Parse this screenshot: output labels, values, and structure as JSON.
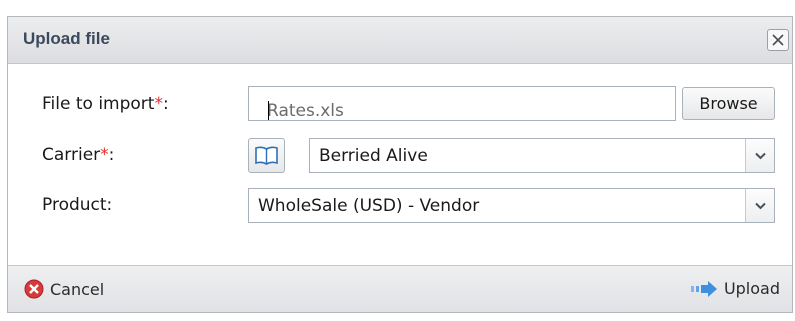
{
  "dialog": {
    "title": "Upload file"
  },
  "form": {
    "file_label": "File to import",
    "file_value": "Rates.xls",
    "browse_label": "Browse",
    "carrier_label": "Carrier",
    "carrier_value": "Berried Alive",
    "product_label": "Product:",
    "product_value": "WholeSale (USD) - Vendor",
    "required_mark": "*",
    "label_suffix": ":"
  },
  "footer": {
    "cancel_label": "Cancel",
    "upload_label": "Upload"
  },
  "icons": {
    "close": "close-icon",
    "book": "book-icon",
    "dropdown": "chevron-down-icon",
    "cancel": "cancel-icon",
    "upload": "upload-arrow-icon"
  },
  "colors": {
    "required": "#e03030",
    "title_text": "#3a4a5c",
    "cancel_icon": "#d63a3a",
    "upload_icon": "#3f8fe0"
  }
}
